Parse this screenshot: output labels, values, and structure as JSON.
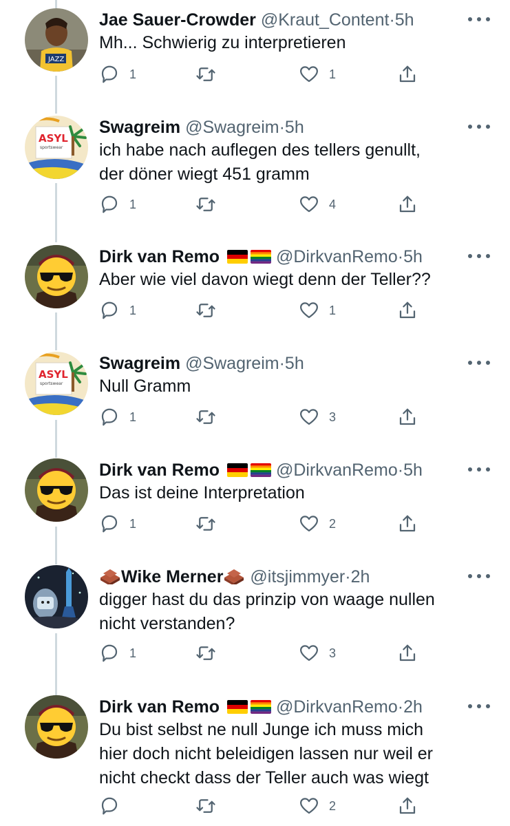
{
  "colors": {
    "text": "#0f1419",
    "secondary": "#536471",
    "thread": "#cfd9de"
  },
  "icons": {
    "reply": "reply-icon",
    "retweet": "retweet-icon",
    "like": "heart-icon",
    "share": "share-icon",
    "more": "more-icon"
  },
  "tweets": [
    {
      "name": "Jae Sauer-Crowder",
      "handle": "@Kraut_Content",
      "sep": "·",
      "time": "5h",
      "text": [
        "Mh... Schwierig zu interpretieren"
      ],
      "replies": "1",
      "likes": "1"
    },
    {
      "name": "Swagreim",
      "handle": "@Swagreim",
      "sep": "·",
      "time": "5h",
      "text": [
        "ich habe nach auflegen des tellers genullt,",
        "der döner wiegt 451 gramm"
      ],
      "replies": "1",
      "likes": "4"
    },
    {
      "name": "Dirk van Remo",
      "handle": "@DirkvanRemo",
      "sep": "·",
      "time": "5h",
      "text": [
        "Aber wie viel davon wiegt denn der Teller??"
      ],
      "replies": "1",
      "likes": "1"
    },
    {
      "name": "Swagreim",
      "handle": "@Swagreim",
      "sep": "·",
      "time": "5h",
      "text": [
        "Null Gramm"
      ],
      "replies": "1",
      "likes": "3"
    },
    {
      "name": "Dirk van Remo",
      "handle": "@DirkvanRemo",
      "sep": "·",
      "time": "5h",
      "text": [
        "Das ist deine Interpretation"
      ],
      "replies": "1",
      "likes": "2"
    },
    {
      "name": "Wike Merner",
      "handle": "@itsjimmyer",
      "sep": "·",
      "time": "2h",
      "text": [
        "digger hast du das prinzip von waage nullen",
        "nicht verstanden?"
      ],
      "replies": "1",
      "likes": "3"
    },
    {
      "name": "Dirk van Remo",
      "handle": "@DirkvanRemo",
      "sep": "·",
      "time": "2h",
      "text": [
        "Du bist selbst ne null Junge ich muss mich",
        "hier doch nicht beleidigen lassen nur weil er",
        "nicht checkt dass der Teller auch was wiegt"
      ],
      "replies": "",
      "likes": "2"
    }
  ]
}
